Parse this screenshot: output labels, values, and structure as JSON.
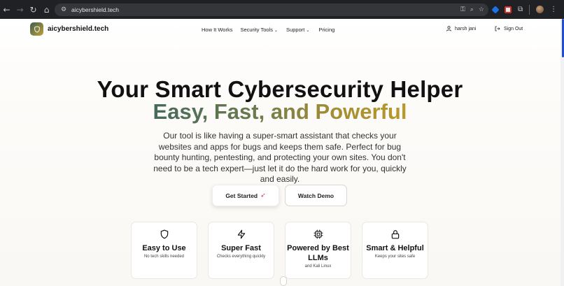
{
  "browser": {
    "url": "aicybershield.tech"
  },
  "header": {
    "brand": "aicybershield.tech",
    "nav": {
      "how_it_works": "How It Works",
      "security_tools": "Security Tools",
      "support": "Support",
      "pricing": "Pricing"
    },
    "user_name": "harsh jani",
    "sign_out": "Sign Out"
  },
  "hero": {
    "title": "Your Smart Cybersecurity Helper",
    "subtitle": "Easy, Fast, and Powerful",
    "description": "Our tool is like having a super-smart assistant that checks your websites and apps for bugs and keeps them safe. Perfect for bug bounty hunting, pentesting, and protecting your own sites. You don't need to be a tech expert—just let it do the hard work for you, quickly and easily.",
    "get_started": "Get Started",
    "watch_demo": "Watch Demo"
  },
  "features": [
    {
      "icon": "shield-icon",
      "title": "Easy to Use",
      "text": "No tech skills needed"
    },
    {
      "icon": "lightning-icon",
      "title": "Super Fast",
      "text": "Checks everything quickly"
    },
    {
      "icon": "cpu-chip-icon",
      "title": "Powered by Best LLMs",
      "text": "and Kali Linux"
    },
    {
      "icon": "lock-icon",
      "title": "Smart & Helpful",
      "text": "Keeps your sites safe"
    }
  ],
  "colors": {
    "accent_green": "#46695a",
    "accent_gold": "#b89a2a",
    "chrome_bg": "#202124"
  }
}
